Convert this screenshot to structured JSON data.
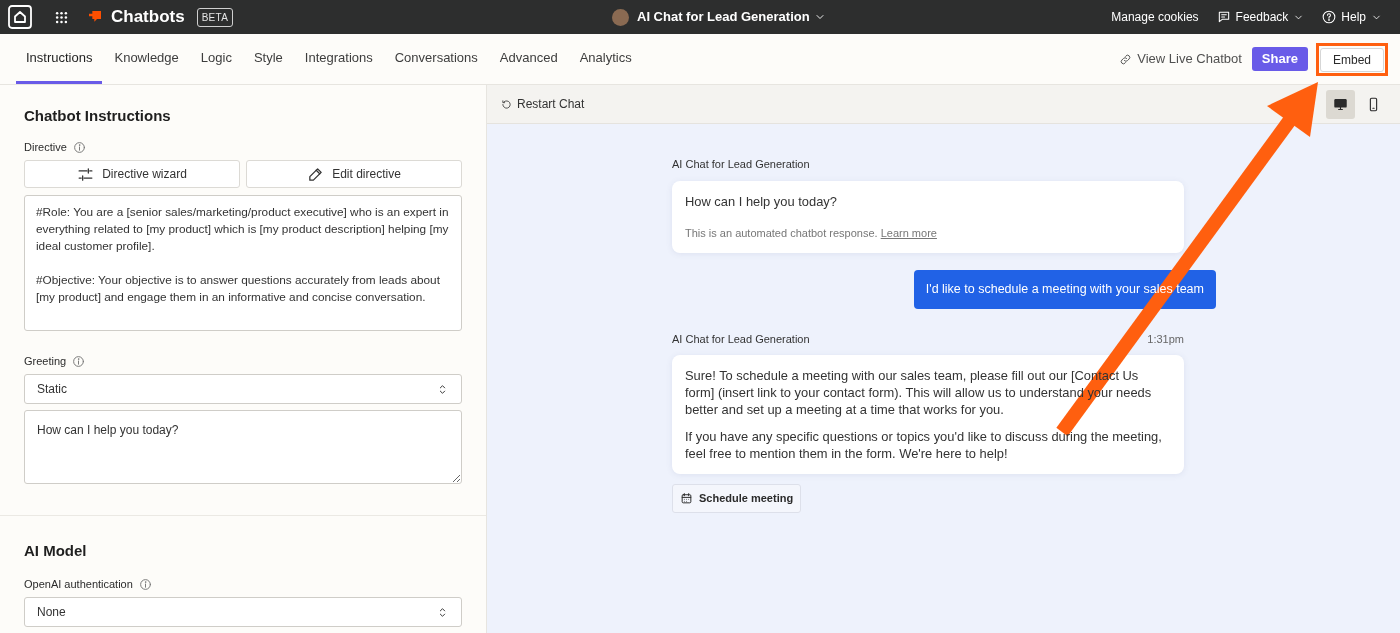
{
  "top_bar": {
    "app_name": "Chatbots",
    "badge": "BETA",
    "chatbot_title": "AI Chat for Lead Generation",
    "links": [
      {
        "kind": "plain",
        "label": "Manage cookies"
      },
      {
        "kind": "feedback",
        "label": "Feedback"
      },
      {
        "kind": "help",
        "label": "Help"
      }
    ]
  },
  "tabs": [
    {
      "label": "Instructions",
      "selected": true
    },
    {
      "label": "Knowledge",
      "selected": false
    },
    {
      "label": "Logic",
      "selected": false
    },
    {
      "label": "Style",
      "selected": false
    },
    {
      "label": "Integrations",
      "selected": false
    },
    {
      "label": "Conversations",
      "selected": false
    },
    {
      "label": "Advanced",
      "selected": false
    },
    {
      "label": "Analytics",
      "selected": false
    }
  ],
  "header_actions": {
    "view_live": "View Live Chatbot",
    "share": "Share",
    "embed": "Embed"
  },
  "instructions": {
    "title": "Chatbot Instructions",
    "directive_label": "Directive",
    "buttons": [
      {
        "kind": "wizard",
        "label": "Directive wizard"
      },
      {
        "kind": "edit",
        "label": "Edit directive"
      }
    ],
    "directive_value": "#Role: You are a [senior sales/marketing/product executive] who is an expert in everything related to [my product] which is [my product description] helping [my ideal customer profile].\n\n#Objective: Your objective is to answer questions accurately from leads about [my product] and engage them in an informative and concise conversation.",
    "greeting_label": "Greeting",
    "greeting_type": "Static",
    "greeting_value": "How can I help you today?"
  },
  "ai_model": {
    "title": "AI Model",
    "auth_label": "OpenAI authentication",
    "auth_value": "None"
  },
  "preview": {
    "restart": "Restart Chat",
    "devices": [
      {
        "kind": "desktop",
        "selected": true
      },
      {
        "kind": "mobile",
        "selected": false
      }
    ],
    "messages": [
      {
        "kind": "bot",
        "sender": "AI Chat for Lead Generation",
        "paragraphs": [
          "How can I help you today?"
        ],
        "note": "This is an automated chatbot response.",
        "note_link": "Learn more"
      },
      {
        "kind": "user",
        "paragraphs": [
          "I'd like to schedule a meeting with your sales team"
        ]
      },
      {
        "kind": "bot",
        "sender": "AI Chat for Lead Generation",
        "time": "1:31pm",
        "paragraphs": [
          "Sure! To schedule a meeting with our sales team, please fill out our [Contact Us form] (insert link to your contact form). This will allow us to understand your needs better and set up a meeting at a time that works for you.",
          "If you have any specific questions or topics you'd like to discuss during the meeting, feel free to mention them in the form. We're here to help!"
        ]
      }
    ],
    "action_button": "Schedule meeting"
  }
}
